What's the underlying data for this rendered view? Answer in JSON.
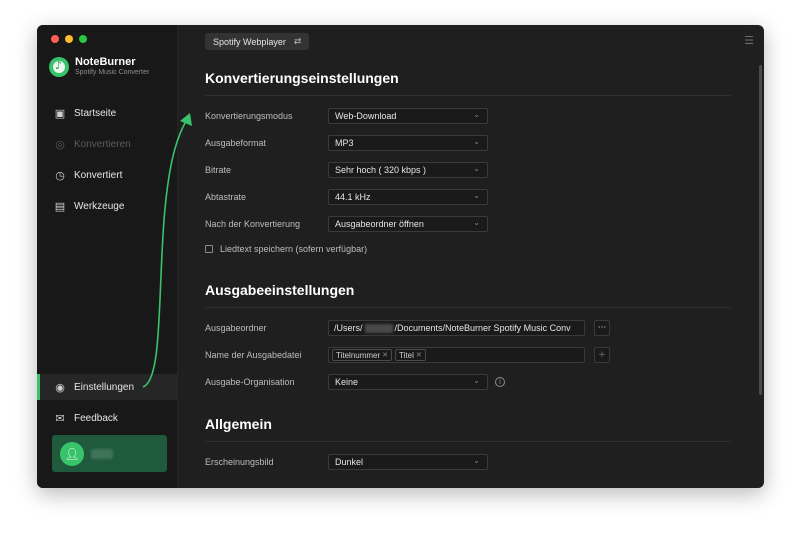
{
  "app": {
    "name": "NoteBurner",
    "subtitle": "Spotify Music Converter"
  },
  "sidebar": {
    "items": [
      {
        "label": "Startseite",
        "icon": "home-icon"
      },
      {
        "label": "Konvertieren",
        "icon": "convert-icon",
        "disabled": true
      },
      {
        "label": "Konvertiert",
        "icon": "clock-icon"
      },
      {
        "label": "Werkzeuge",
        "icon": "toolbox-icon"
      },
      {
        "label": "Einstellungen",
        "icon": "settings-icon",
        "active": true
      },
      {
        "label": "Feedback",
        "icon": "mail-icon"
      }
    ]
  },
  "header": {
    "source_label": "Spotify Webplayer",
    "source_icon": "swap-icon",
    "menu_icon": "hamburger-icon"
  },
  "conversion": {
    "title": "Konvertierungseinstellungen",
    "rows": [
      {
        "label": "Konvertierungsmodus",
        "value": "Web-Download"
      },
      {
        "label": "Ausgabeformat",
        "value": "MP3"
      },
      {
        "label": "Bitrate",
        "value": "Sehr hoch ( 320 kbps )"
      },
      {
        "label": "Abtastrate",
        "value": "44.1 kHz"
      },
      {
        "label": "Nach der Konvertierung",
        "value": "Ausgabeordner öffnen"
      }
    ],
    "lyrics_label": "Liedtext speichern (sofern verfügbar)"
  },
  "output": {
    "title": "Ausgabeeinstellungen",
    "folder_label": "Ausgabeordner",
    "folder_prefix": "/Users/",
    "folder_suffix": "/Documents/NoteBurner Spotify Music Conv",
    "browse_label": "···",
    "filename_label": "Name der Ausgabedatei",
    "filename_tags": [
      "Titelnummer",
      "Titel"
    ],
    "add_label": "+",
    "organization_label": "Ausgabe-Organisation",
    "organization_value": "Keine"
  },
  "general": {
    "title": "Allgemein",
    "appearance_label": "Erscheinungsbild",
    "appearance_value": "Dunkel"
  },
  "colors": {
    "accent": "#38c36b",
    "background": "#1f1f1f",
    "sidebar": "#181818",
    "user_card": "#1e5a3b"
  }
}
